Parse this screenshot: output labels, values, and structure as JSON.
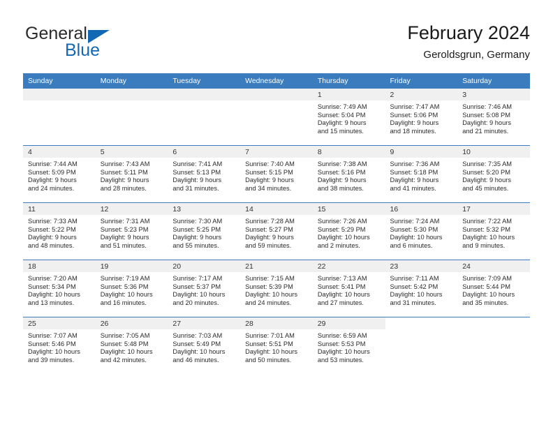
{
  "brand": {
    "name_top": "General",
    "name_bottom": "Blue",
    "triangle_color": "#1268b3"
  },
  "header": {
    "title": "February 2024",
    "subtitle": "Geroldsgrun, Germany"
  },
  "calendar": {
    "accent_color": "#3a7cbe",
    "weekday_headers": [
      "Sunday",
      "Monday",
      "Tuesday",
      "Wednesday",
      "Thursday",
      "Friday",
      "Saturday"
    ],
    "weeks": [
      [
        {
          "day": "",
          "sunrise": "",
          "sunset": "",
          "daylight_line1": "",
          "daylight_line2": ""
        },
        {
          "day": "",
          "sunrise": "",
          "sunset": "",
          "daylight_line1": "",
          "daylight_line2": ""
        },
        {
          "day": "",
          "sunrise": "",
          "sunset": "",
          "daylight_line1": "",
          "daylight_line2": ""
        },
        {
          "day": "",
          "sunrise": "",
          "sunset": "",
          "daylight_line1": "",
          "daylight_line2": ""
        },
        {
          "day": "1",
          "sunrise": "Sunrise: 7:49 AM",
          "sunset": "Sunset: 5:04 PM",
          "daylight_line1": "Daylight: 9 hours",
          "daylight_line2": "and 15 minutes."
        },
        {
          "day": "2",
          "sunrise": "Sunrise: 7:47 AM",
          "sunset": "Sunset: 5:06 PM",
          "daylight_line1": "Daylight: 9 hours",
          "daylight_line2": "and 18 minutes."
        },
        {
          "day": "3",
          "sunrise": "Sunrise: 7:46 AM",
          "sunset": "Sunset: 5:08 PM",
          "daylight_line1": "Daylight: 9 hours",
          "daylight_line2": "and 21 minutes."
        }
      ],
      [
        {
          "day": "4",
          "sunrise": "Sunrise: 7:44 AM",
          "sunset": "Sunset: 5:09 PM",
          "daylight_line1": "Daylight: 9 hours",
          "daylight_line2": "and 24 minutes."
        },
        {
          "day": "5",
          "sunrise": "Sunrise: 7:43 AM",
          "sunset": "Sunset: 5:11 PM",
          "daylight_line1": "Daylight: 9 hours",
          "daylight_line2": "and 28 minutes."
        },
        {
          "day": "6",
          "sunrise": "Sunrise: 7:41 AM",
          "sunset": "Sunset: 5:13 PM",
          "daylight_line1": "Daylight: 9 hours",
          "daylight_line2": "and 31 minutes."
        },
        {
          "day": "7",
          "sunrise": "Sunrise: 7:40 AM",
          "sunset": "Sunset: 5:15 PM",
          "daylight_line1": "Daylight: 9 hours",
          "daylight_line2": "and 34 minutes."
        },
        {
          "day": "8",
          "sunrise": "Sunrise: 7:38 AM",
          "sunset": "Sunset: 5:16 PM",
          "daylight_line1": "Daylight: 9 hours",
          "daylight_line2": "and 38 minutes."
        },
        {
          "day": "9",
          "sunrise": "Sunrise: 7:36 AM",
          "sunset": "Sunset: 5:18 PM",
          "daylight_line1": "Daylight: 9 hours",
          "daylight_line2": "and 41 minutes."
        },
        {
          "day": "10",
          "sunrise": "Sunrise: 7:35 AM",
          "sunset": "Sunset: 5:20 PM",
          "daylight_line1": "Daylight: 9 hours",
          "daylight_line2": "and 45 minutes."
        }
      ],
      [
        {
          "day": "11",
          "sunrise": "Sunrise: 7:33 AM",
          "sunset": "Sunset: 5:22 PM",
          "daylight_line1": "Daylight: 9 hours",
          "daylight_line2": "and 48 minutes."
        },
        {
          "day": "12",
          "sunrise": "Sunrise: 7:31 AM",
          "sunset": "Sunset: 5:23 PM",
          "daylight_line1": "Daylight: 9 hours",
          "daylight_line2": "and 51 minutes."
        },
        {
          "day": "13",
          "sunrise": "Sunrise: 7:30 AM",
          "sunset": "Sunset: 5:25 PM",
          "daylight_line1": "Daylight: 9 hours",
          "daylight_line2": "and 55 minutes."
        },
        {
          "day": "14",
          "sunrise": "Sunrise: 7:28 AM",
          "sunset": "Sunset: 5:27 PM",
          "daylight_line1": "Daylight: 9 hours",
          "daylight_line2": "and 59 minutes."
        },
        {
          "day": "15",
          "sunrise": "Sunrise: 7:26 AM",
          "sunset": "Sunset: 5:29 PM",
          "daylight_line1": "Daylight: 10 hours",
          "daylight_line2": "and 2 minutes."
        },
        {
          "day": "16",
          "sunrise": "Sunrise: 7:24 AM",
          "sunset": "Sunset: 5:30 PM",
          "daylight_line1": "Daylight: 10 hours",
          "daylight_line2": "and 6 minutes."
        },
        {
          "day": "17",
          "sunrise": "Sunrise: 7:22 AM",
          "sunset": "Sunset: 5:32 PM",
          "daylight_line1": "Daylight: 10 hours",
          "daylight_line2": "and 9 minutes."
        }
      ],
      [
        {
          "day": "18",
          "sunrise": "Sunrise: 7:20 AM",
          "sunset": "Sunset: 5:34 PM",
          "daylight_line1": "Daylight: 10 hours",
          "daylight_line2": "and 13 minutes."
        },
        {
          "day": "19",
          "sunrise": "Sunrise: 7:19 AM",
          "sunset": "Sunset: 5:36 PM",
          "daylight_line1": "Daylight: 10 hours",
          "daylight_line2": "and 16 minutes."
        },
        {
          "day": "20",
          "sunrise": "Sunrise: 7:17 AM",
          "sunset": "Sunset: 5:37 PM",
          "daylight_line1": "Daylight: 10 hours",
          "daylight_line2": "and 20 minutes."
        },
        {
          "day": "21",
          "sunrise": "Sunrise: 7:15 AM",
          "sunset": "Sunset: 5:39 PM",
          "daylight_line1": "Daylight: 10 hours",
          "daylight_line2": "and 24 minutes."
        },
        {
          "day": "22",
          "sunrise": "Sunrise: 7:13 AM",
          "sunset": "Sunset: 5:41 PM",
          "daylight_line1": "Daylight: 10 hours",
          "daylight_line2": "and 27 minutes."
        },
        {
          "day": "23",
          "sunrise": "Sunrise: 7:11 AM",
          "sunset": "Sunset: 5:42 PM",
          "daylight_line1": "Daylight: 10 hours",
          "daylight_line2": "and 31 minutes."
        },
        {
          "day": "24",
          "sunrise": "Sunrise: 7:09 AM",
          "sunset": "Sunset: 5:44 PM",
          "daylight_line1": "Daylight: 10 hours",
          "daylight_line2": "and 35 minutes."
        }
      ],
      [
        {
          "day": "25",
          "sunrise": "Sunrise: 7:07 AM",
          "sunset": "Sunset: 5:46 PM",
          "daylight_line1": "Daylight: 10 hours",
          "daylight_line2": "and 39 minutes."
        },
        {
          "day": "26",
          "sunrise": "Sunrise: 7:05 AM",
          "sunset": "Sunset: 5:48 PM",
          "daylight_line1": "Daylight: 10 hours",
          "daylight_line2": "and 42 minutes."
        },
        {
          "day": "27",
          "sunrise": "Sunrise: 7:03 AM",
          "sunset": "Sunset: 5:49 PM",
          "daylight_line1": "Daylight: 10 hours",
          "daylight_line2": "and 46 minutes."
        },
        {
          "day": "28",
          "sunrise": "Sunrise: 7:01 AM",
          "sunset": "Sunset: 5:51 PM",
          "daylight_line1": "Daylight: 10 hours",
          "daylight_line2": "and 50 minutes."
        },
        {
          "day": "29",
          "sunrise": "Sunrise: 6:59 AM",
          "sunset": "Sunset: 5:53 PM",
          "daylight_line1": "Daylight: 10 hours",
          "daylight_line2": "and 53 minutes."
        },
        {
          "day": "",
          "sunrise": "",
          "sunset": "",
          "daylight_line1": "",
          "daylight_line2": ""
        },
        {
          "day": "",
          "sunrise": "",
          "sunset": "",
          "daylight_line1": "",
          "daylight_line2": ""
        }
      ]
    ]
  }
}
